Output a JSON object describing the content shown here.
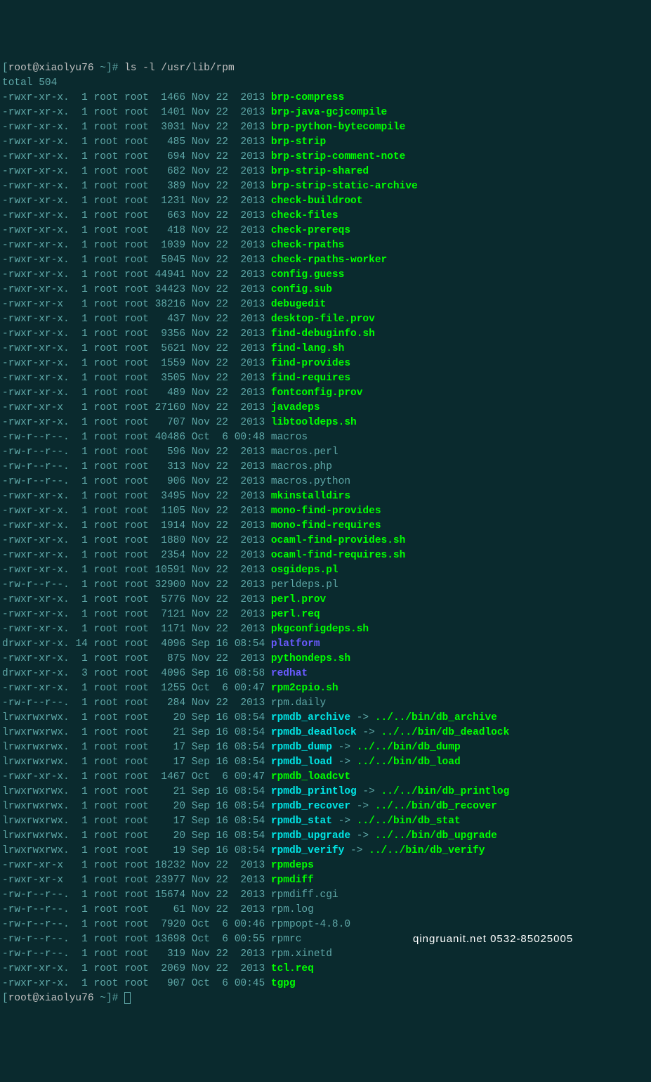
{
  "prompt": {
    "br_open": "[",
    "user": "root@xiaolyu76",
    "path": " ~",
    "br_close": "]# ",
    "command": "ls -l /usr/lib/rpm"
  },
  "total": "total 504",
  "rows": [
    {
      "perm": "-rwxr-xr-x.",
      "links": "1",
      "owner": "root",
      "group": "root",
      "size": "1466",
      "date": "Nov 22  2013",
      "name": "brp-compress",
      "type": "exec"
    },
    {
      "perm": "-rwxr-xr-x.",
      "links": "1",
      "owner": "root",
      "group": "root",
      "size": "1401",
      "date": "Nov 22  2013",
      "name": "brp-java-gcjcompile",
      "type": "exec"
    },
    {
      "perm": "-rwxr-xr-x.",
      "links": "1",
      "owner": "root",
      "group": "root",
      "size": "3031",
      "date": "Nov 22  2013",
      "name": "brp-python-bytecompile",
      "type": "exec"
    },
    {
      "perm": "-rwxr-xr-x.",
      "links": "1",
      "owner": "root",
      "group": "root",
      "size": "485",
      "date": "Nov 22  2013",
      "name": "brp-strip",
      "type": "exec"
    },
    {
      "perm": "-rwxr-xr-x.",
      "links": "1",
      "owner": "root",
      "group": "root",
      "size": "694",
      "date": "Nov 22  2013",
      "name": "brp-strip-comment-note",
      "type": "exec"
    },
    {
      "perm": "-rwxr-xr-x.",
      "links": "1",
      "owner": "root",
      "group": "root",
      "size": "682",
      "date": "Nov 22  2013",
      "name": "brp-strip-shared",
      "type": "exec"
    },
    {
      "perm": "-rwxr-xr-x.",
      "links": "1",
      "owner": "root",
      "group": "root",
      "size": "389",
      "date": "Nov 22  2013",
      "name": "brp-strip-static-archive",
      "type": "exec"
    },
    {
      "perm": "-rwxr-xr-x.",
      "links": "1",
      "owner": "root",
      "group": "root",
      "size": "1231",
      "date": "Nov 22  2013",
      "name": "check-buildroot",
      "type": "exec"
    },
    {
      "perm": "-rwxr-xr-x.",
      "links": "1",
      "owner": "root",
      "group": "root",
      "size": "663",
      "date": "Nov 22  2013",
      "name": "check-files",
      "type": "exec"
    },
    {
      "perm": "-rwxr-xr-x.",
      "links": "1",
      "owner": "root",
      "group": "root",
      "size": "418",
      "date": "Nov 22  2013",
      "name": "check-prereqs",
      "type": "exec"
    },
    {
      "perm": "-rwxr-xr-x.",
      "links": "1",
      "owner": "root",
      "group": "root",
      "size": "1039",
      "date": "Nov 22  2013",
      "name": "check-rpaths",
      "type": "exec"
    },
    {
      "perm": "-rwxr-xr-x.",
      "links": "1",
      "owner": "root",
      "group": "root",
      "size": "5045",
      "date": "Nov 22  2013",
      "name": "check-rpaths-worker",
      "type": "exec"
    },
    {
      "perm": "-rwxr-xr-x.",
      "links": "1",
      "owner": "root",
      "group": "root",
      "size": "44941",
      "date": "Nov 22  2013",
      "name": "config.guess",
      "type": "exec"
    },
    {
      "perm": "-rwxr-xr-x.",
      "links": "1",
      "owner": "root",
      "group": "root",
      "size": "34423",
      "date": "Nov 22  2013",
      "name": "config.sub",
      "type": "exec"
    },
    {
      "perm": "-rwxr-xr-x",
      "links": "1",
      "owner": "root",
      "group": "root",
      "size": "38216",
      "date": "Nov 22  2013",
      "name": "debugedit",
      "type": "exec"
    },
    {
      "perm": "-rwxr-xr-x.",
      "links": "1",
      "owner": "root",
      "group": "root",
      "size": "437",
      "date": "Nov 22  2013",
      "name": "desktop-file.prov",
      "type": "exec"
    },
    {
      "perm": "-rwxr-xr-x.",
      "links": "1",
      "owner": "root",
      "group": "root",
      "size": "9356",
      "date": "Nov 22  2013",
      "name": "find-debuginfo.sh",
      "type": "exec"
    },
    {
      "perm": "-rwxr-xr-x.",
      "links": "1",
      "owner": "root",
      "group": "root",
      "size": "5621",
      "date": "Nov 22  2013",
      "name": "find-lang.sh",
      "type": "exec"
    },
    {
      "perm": "-rwxr-xr-x.",
      "links": "1",
      "owner": "root",
      "group": "root",
      "size": "1559",
      "date": "Nov 22  2013",
      "name": "find-provides",
      "type": "exec"
    },
    {
      "perm": "-rwxr-xr-x.",
      "links": "1",
      "owner": "root",
      "group": "root",
      "size": "3505",
      "date": "Nov 22  2013",
      "name": "find-requires",
      "type": "exec"
    },
    {
      "perm": "-rwxr-xr-x.",
      "links": "1",
      "owner": "root",
      "group": "root",
      "size": "489",
      "date": "Nov 22  2013",
      "name": "fontconfig.prov",
      "type": "exec"
    },
    {
      "perm": "-rwxr-xr-x",
      "links": "1",
      "owner": "root",
      "group": "root",
      "size": "27160",
      "date": "Nov 22  2013",
      "name": "javadeps",
      "type": "exec"
    },
    {
      "perm": "-rwxr-xr-x.",
      "links": "1",
      "owner": "root",
      "group": "root",
      "size": "707",
      "date": "Nov 22  2013",
      "name": "libtooldeps.sh",
      "type": "exec"
    },
    {
      "perm": "-rw-r--r--.",
      "links": "1",
      "owner": "root",
      "group": "root",
      "size": "40486",
      "date": "Oct  6 00:48",
      "name": "macros",
      "type": "plain"
    },
    {
      "perm": "-rw-r--r--.",
      "links": "1",
      "owner": "root",
      "group": "root",
      "size": "596",
      "date": "Nov 22  2013",
      "name": "macros.perl",
      "type": "plain"
    },
    {
      "perm": "-rw-r--r--.",
      "links": "1",
      "owner": "root",
      "group": "root",
      "size": "313",
      "date": "Nov 22  2013",
      "name": "macros.php",
      "type": "plain"
    },
    {
      "perm": "-rw-r--r--.",
      "links": "1",
      "owner": "root",
      "group": "root",
      "size": "906",
      "date": "Nov 22  2013",
      "name": "macros.python",
      "type": "plain"
    },
    {
      "perm": "-rwxr-xr-x.",
      "links": "1",
      "owner": "root",
      "group": "root",
      "size": "3495",
      "date": "Nov 22  2013",
      "name": "mkinstalldirs",
      "type": "exec"
    },
    {
      "perm": "-rwxr-xr-x.",
      "links": "1",
      "owner": "root",
      "group": "root",
      "size": "1105",
      "date": "Nov 22  2013",
      "name": "mono-find-provides",
      "type": "exec"
    },
    {
      "perm": "-rwxr-xr-x.",
      "links": "1",
      "owner": "root",
      "group": "root",
      "size": "1914",
      "date": "Nov 22  2013",
      "name": "mono-find-requires",
      "type": "exec"
    },
    {
      "perm": "-rwxr-xr-x.",
      "links": "1",
      "owner": "root",
      "group": "root",
      "size": "1880",
      "date": "Nov 22  2013",
      "name": "ocaml-find-provides.sh",
      "type": "exec"
    },
    {
      "perm": "-rwxr-xr-x.",
      "links": "1",
      "owner": "root",
      "group": "root",
      "size": "2354",
      "date": "Nov 22  2013",
      "name": "ocaml-find-requires.sh",
      "type": "exec"
    },
    {
      "perm": "-rwxr-xr-x.",
      "links": "1",
      "owner": "root",
      "group": "root",
      "size": "10591",
      "date": "Nov 22  2013",
      "name": "osgideps.pl",
      "type": "exec"
    },
    {
      "perm": "-rw-r--r--.",
      "links": "1",
      "owner": "root",
      "group": "root",
      "size": "32900",
      "date": "Nov 22  2013",
      "name": "perldeps.pl",
      "type": "plain"
    },
    {
      "perm": "-rwxr-xr-x.",
      "links": "1",
      "owner": "root",
      "group": "root",
      "size": "5776",
      "date": "Nov 22  2013",
      "name": "perl.prov",
      "type": "exec"
    },
    {
      "perm": "-rwxr-xr-x.",
      "links": "1",
      "owner": "root",
      "group": "root",
      "size": "7121",
      "date": "Nov 22  2013",
      "name": "perl.req",
      "type": "exec"
    },
    {
      "perm": "-rwxr-xr-x.",
      "links": "1",
      "owner": "root",
      "group": "root",
      "size": "1171",
      "date": "Nov 22  2013",
      "name": "pkgconfigdeps.sh",
      "type": "exec"
    },
    {
      "perm": "drwxr-xr-x.",
      "links": "14",
      "owner": "root",
      "group": "root",
      "size": "4096",
      "date": "Sep 16 08:54",
      "name": "platform",
      "type": "dir"
    },
    {
      "perm": "-rwxr-xr-x.",
      "links": "1",
      "owner": "root",
      "group": "root",
      "size": "875",
      "date": "Nov 22  2013",
      "name": "pythondeps.sh",
      "type": "exec"
    },
    {
      "perm": "drwxr-xr-x.",
      "links": "3",
      "owner": "root",
      "group": "root",
      "size": "4096",
      "date": "Sep 16 08:58",
      "name": "redhat",
      "type": "dir"
    },
    {
      "perm": "-rwxr-xr-x.",
      "links": "1",
      "owner": "root",
      "group": "root",
      "size": "1255",
      "date": "Oct  6 00:47",
      "name": "rpm2cpio.sh",
      "type": "exec"
    },
    {
      "perm": "-rw-r--r--.",
      "links": "1",
      "owner": "root",
      "group": "root",
      "size": "284",
      "date": "Nov 22  2013",
      "name": "rpm.daily",
      "type": "plain"
    },
    {
      "perm": "lrwxrwxrwx.",
      "links": "1",
      "owner": "root",
      "group": "root",
      "size": "20",
      "date": "Sep 16 08:54",
      "name": "rpmdb_archive",
      "type": "link",
      "arrow": " -> ",
      "target": "../../bin/db_archive"
    },
    {
      "perm": "lrwxrwxrwx.",
      "links": "1",
      "owner": "root",
      "group": "root",
      "size": "21",
      "date": "Sep 16 08:54",
      "name": "rpmdb_deadlock",
      "type": "link",
      "arrow": " -> ",
      "target": "../../bin/db_deadlock"
    },
    {
      "perm": "lrwxrwxrwx.",
      "links": "1",
      "owner": "root",
      "group": "root",
      "size": "17",
      "date": "Sep 16 08:54",
      "name": "rpmdb_dump",
      "type": "link",
      "arrow": " -> ",
      "target": "../../bin/db_dump"
    },
    {
      "perm": "lrwxrwxrwx.",
      "links": "1",
      "owner": "root",
      "group": "root",
      "size": "17",
      "date": "Sep 16 08:54",
      "name": "rpmdb_load",
      "type": "link",
      "arrow": " -> ",
      "target": "../../bin/db_load"
    },
    {
      "perm": "-rwxr-xr-x.",
      "links": "1",
      "owner": "root",
      "group": "root",
      "size": "1467",
      "date": "Oct  6 00:47",
      "name": "rpmdb_loadcvt",
      "type": "exec"
    },
    {
      "perm": "lrwxrwxrwx.",
      "links": "1",
      "owner": "root",
      "group": "root",
      "size": "21",
      "date": "Sep 16 08:54",
      "name": "rpmdb_printlog",
      "type": "link",
      "arrow": " -> ",
      "target": "../../bin/db_printlog"
    },
    {
      "perm": "lrwxrwxrwx.",
      "links": "1",
      "owner": "root",
      "group": "root",
      "size": "20",
      "date": "Sep 16 08:54",
      "name": "rpmdb_recover",
      "type": "link",
      "arrow": " -> ",
      "target": "../../bin/db_recover"
    },
    {
      "perm": "lrwxrwxrwx.",
      "links": "1",
      "owner": "root",
      "group": "root",
      "size": "17",
      "date": "Sep 16 08:54",
      "name": "rpmdb_stat",
      "type": "link",
      "arrow": " -> ",
      "target": "../../bin/db_stat"
    },
    {
      "perm": "lrwxrwxrwx.",
      "links": "1",
      "owner": "root",
      "group": "root",
      "size": "20",
      "date": "Sep 16 08:54",
      "name": "rpmdb_upgrade",
      "type": "link",
      "arrow": " -> ",
      "target": "../../bin/db_upgrade"
    },
    {
      "perm": "lrwxrwxrwx.",
      "links": "1",
      "owner": "root",
      "group": "root",
      "size": "19",
      "date": "Sep 16 08:54",
      "name": "rpmdb_verify",
      "type": "link",
      "arrow": " -> ",
      "target": "../../bin/db_verify"
    },
    {
      "perm": "-rwxr-xr-x",
      "links": "1",
      "owner": "root",
      "group": "root",
      "size": "18232",
      "date": "Nov 22  2013",
      "name": "rpmdeps",
      "type": "exec"
    },
    {
      "perm": "-rwxr-xr-x",
      "links": "1",
      "owner": "root",
      "group": "root",
      "size": "23977",
      "date": "Nov 22  2013",
      "name": "rpmdiff",
      "type": "exec"
    },
    {
      "perm": "-rw-r--r--.",
      "links": "1",
      "owner": "root",
      "group": "root",
      "size": "15674",
      "date": "Nov 22  2013",
      "name": "rpmdiff.cgi",
      "type": "plain"
    },
    {
      "perm": "-rw-r--r--.",
      "links": "1",
      "owner": "root",
      "group": "root",
      "size": "61",
      "date": "Nov 22  2013",
      "name": "rpm.log",
      "type": "plain"
    },
    {
      "perm": "-rw-r--r--.",
      "links": "1",
      "owner": "root",
      "group": "root",
      "size": "7920",
      "date": "Oct  6 00:46",
      "name": "rpmpopt-4.8.0",
      "type": "plain"
    },
    {
      "perm": "-rw-r--r--.",
      "links": "1",
      "owner": "root",
      "group": "root",
      "size": "13698",
      "date": "Oct  6 00:55",
      "name": "rpmrc",
      "type": "plain"
    },
    {
      "perm": "-rw-r--r--.",
      "links": "1",
      "owner": "root",
      "group": "root",
      "size": "319",
      "date": "Nov 22  2013",
      "name": "rpm.xinetd",
      "type": "plain"
    },
    {
      "perm": "-rwxr-xr-x.",
      "links": "1",
      "owner": "root",
      "group": "root",
      "size": "2069",
      "date": "Nov 22  2013",
      "name": "tcl.req",
      "type": "exec"
    },
    {
      "perm": "-rwxr-xr-x.",
      "links": "1",
      "owner": "root",
      "group": "root",
      "size": "907",
      "date": "Oct  6 00:45",
      "name": "tgpg",
      "type": "exec"
    }
  ],
  "watermark": "qingruanit.net 0532-85025005"
}
